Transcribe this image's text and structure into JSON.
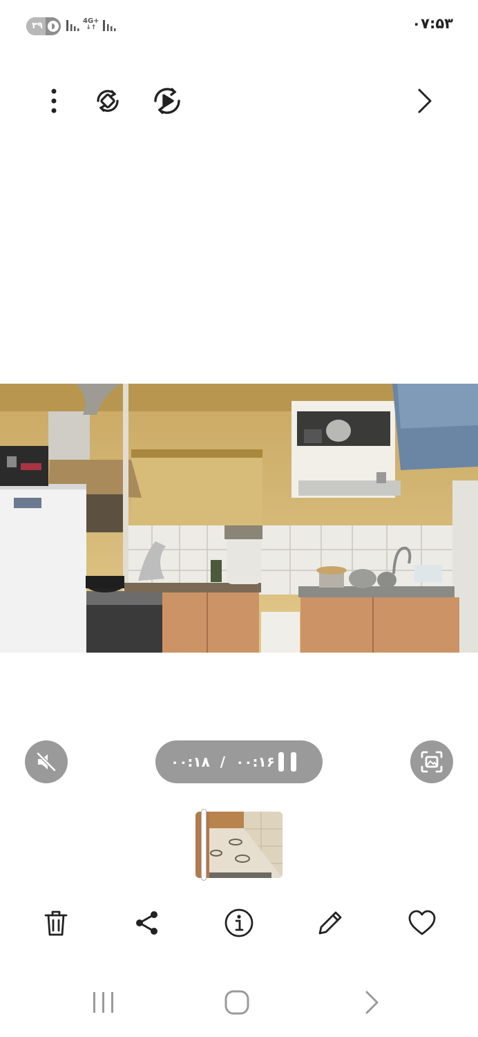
{
  "status_bar": {
    "battery_level": "۳۹",
    "battery_percent": 39,
    "network_type": "4G+",
    "clock": "۰۷:۵۳"
  },
  "top_toolbar": {
    "icons": [
      "more-options-icon",
      "rotate-icon",
      "motion-play-icon",
      "next-icon"
    ]
  },
  "player": {
    "elapsed": "۰۰:۱۶",
    "separator": "/",
    "duration": "۰۰:۱۸",
    "state": "playing",
    "muted": true
  },
  "colors": {
    "control_gray": "#9a9a9a",
    "wall_yellow": "#d9b86a",
    "cabinet_wood": "#cc9466"
  },
  "bottom_actions": {
    "icons": [
      "delete-icon",
      "share-icon",
      "info-icon",
      "edit-icon",
      "favorite-icon"
    ]
  },
  "nav_bar": {
    "icons": [
      "recent-apps-icon",
      "home-icon",
      "back-icon"
    ]
  }
}
